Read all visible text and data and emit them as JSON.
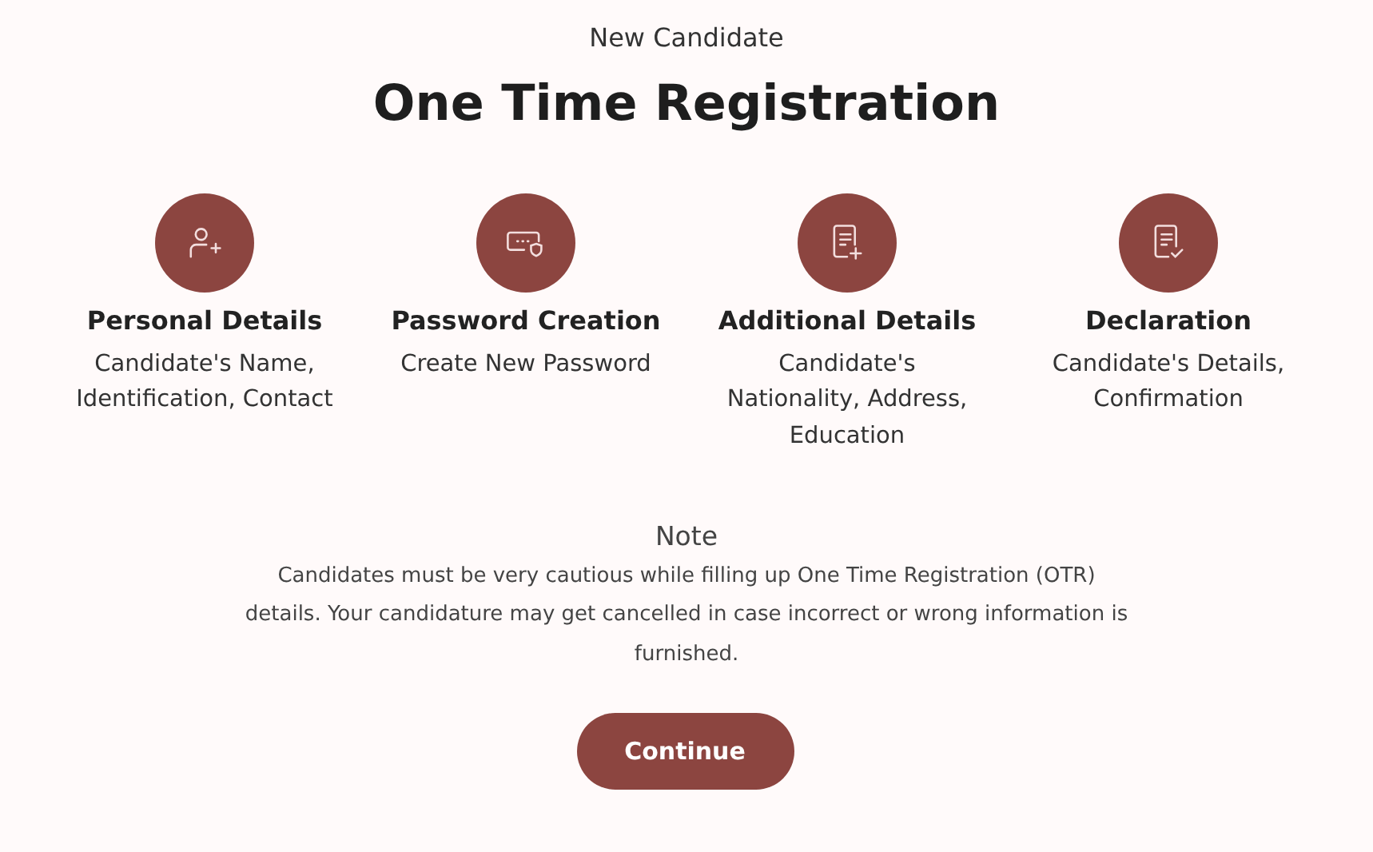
{
  "subtitle": "New Candidate",
  "title": "One Time Registration",
  "steps": [
    {
      "kind": "person-add",
      "title": "Personal Details",
      "lines": [
        "Candidate's Name,",
        "Identification, Contact"
      ]
    },
    {
      "kind": "password",
      "title": "Password Creation",
      "lines": [
        "Create New Password"
      ]
    },
    {
      "kind": "doc-add",
      "title": "Additional Details",
      "lines": [
        "Candidate's",
        "Nationality, Address,",
        "Education"
      ]
    },
    {
      "kind": "doc-check",
      "title": "Declaration",
      "lines": [
        "Candidate's Details,",
        "Confirmation"
      ]
    }
  ],
  "note": {
    "heading": "Note",
    "lines": [
      "Candidates must be very cautious while filling up One Time Registration (OTR)",
      "details. Your candidature may get cancelled in case incorrect or wrong information is",
      "furnished."
    ]
  },
  "button": "Continue"
}
